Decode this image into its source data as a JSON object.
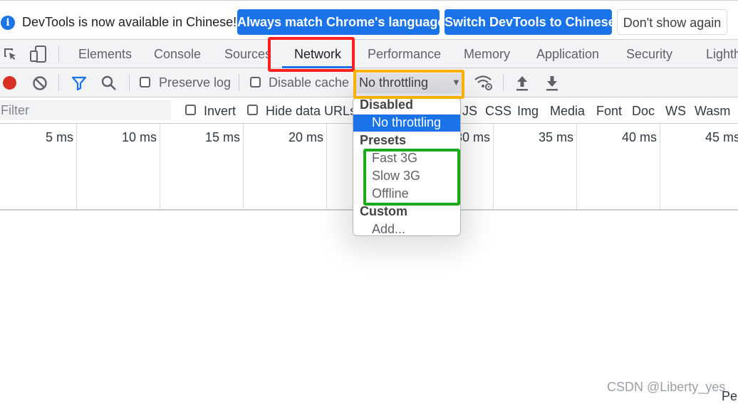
{
  "infobar": {
    "message": "DevTools is now available in Chinese!",
    "btn_match": "Always match Chrome's language",
    "btn_switch": "Switch DevTools to Chinese",
    "btn_dismiss": "Don't show again"
  },
  "tabs": [
    "Elements",
    "Console",
    "Sources",
    "Network",
    "Performance",
    "Memory",
    "Application",
    "Security",
    "Lighth"
  ],
  "active_tab": "Network",
  "toolbar": {
    "preserve_log": "Preserve log",
    "disable_cache": "Disable cache",
    "throttling_value": "No throttling"
  },
  "filterbar": {
    "placeholder": "Filter",
    "invert": "Invert",
    "hide_data_urls": "Hide data URLs",
    "types": [
      "JS",
      "CSS",
      "Img",
      "Media",
      "Font",
      "Doc",
      "WS",
      "Wasm"
    ]
  },
  "timeline": {
    "ticks": [
      "5 ms",
      "10 ms",
      "15 ms",
      "20 ms",
      "30 ms",
      "35 ms",
      "40 ms",
      "45 ms"
    ]
  },
  "dropdown": {
    "group_disabled": "Disabled",
    "opt_no_throttling": "No throttling",
    "group_presets": "Presets",
    "opt_fast3g": "Fast 3G",
    "opt_slow3g": "Slow 3G",
    "opt_offline": "Offline",
    "group_custom": "Custom",
    "opt_add": "Add..."
  },
  "colors": {
    "accent": "#1a73e8",
    "record": "#d93025",
    "annotation_red": "#ff2020",
    "annotation_orange": "#f9b000",
    "annotation_green": "#1aaa1a"
  },
  "watermark": "CSDN @Liberty_yes",
  "status_fragment": "Pe"
}
